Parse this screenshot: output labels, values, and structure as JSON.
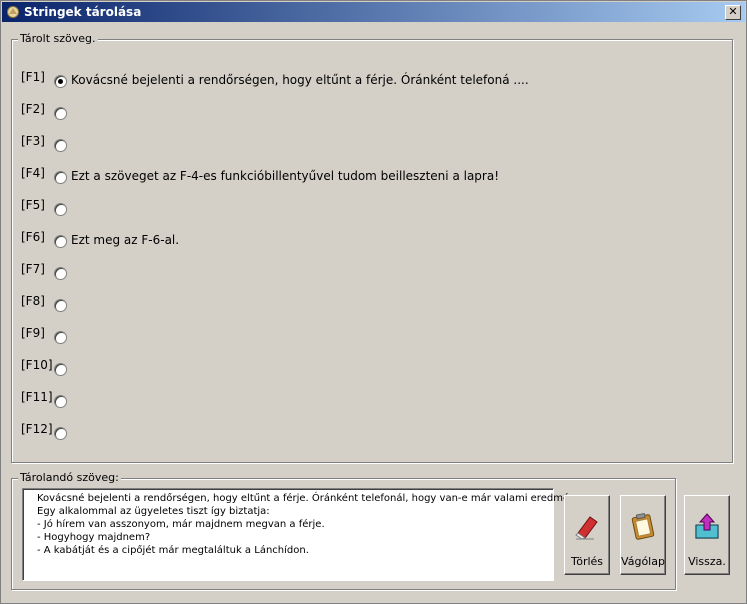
{
  "window": {
    "title": "Stringek tárolása",
    "close_label": "✕"
  },
  "stored": {
    "legend": "Tárolt szöveg.",
    "slots": [
      {
        "key": "[F1]",
        "text": "Kovácsné bejelenti a rendőrségen, hogy eltűnt a férje. Óránként telefoná ....",
        "selected": true
      },
      {
        "key": "[F2]",
        "text": "",
        "selected": false
      },
      {
        "key": "[F3]",
        "text": "",
        "selected": false
      },
      {
        "key": "[F4]",
        "text": "Ezt a szöveget az F-4-es funkcióbillentyűvel tudom beilleszteni a lapra!",
        "selected": false
      },
      {
        "key": "[F5]",
        "text": "",
        "selected": false
      },
      {
        "key": "[F6]",
        "text": "Ezt meg az F-6-al.",
        "selected": false
      },
      {
        "key": "[F7]",
        "text": "",
        "selected": false
      },
      {
        "key": "[F8]",
        "text": "",
        "selected": false
      },
      {
        "key": "[F9]",
        "text": "",
        "selected": false
      },
      {
        "key": "[F10]",
        "text": "",
        "selected": false
      },
      {
        "key": "[F11]",
        "text": "",
        "selected": false
      },
      {
        "key": "[F12]",
        "text": "",
        "selected": false
      }
    ]
  },
  "editor": {
    "legend": "Tárolandó szöveg:",
    "lines": [
      "Kovácsné bejelenti a rendőrségen, hogy eltűnt a férje. Óránként telefonál, hogy van-e már valami eredmény.",
      "Egy alkalommal az ügyeletes tiszt így biztatja:",
      "- Jó hírem van asszonyom, már majdnem megvan a férje.",
      "- Hogyhogy majdnem?",
      "- A kabátját és a cipőjét már megtaláltuk a Lánchídon."
    ]
  },
  "buttons": {
    "delete": "Törlés",
    "clipboard": "Vágólap",
    "back": "Vissza."
  }
}
